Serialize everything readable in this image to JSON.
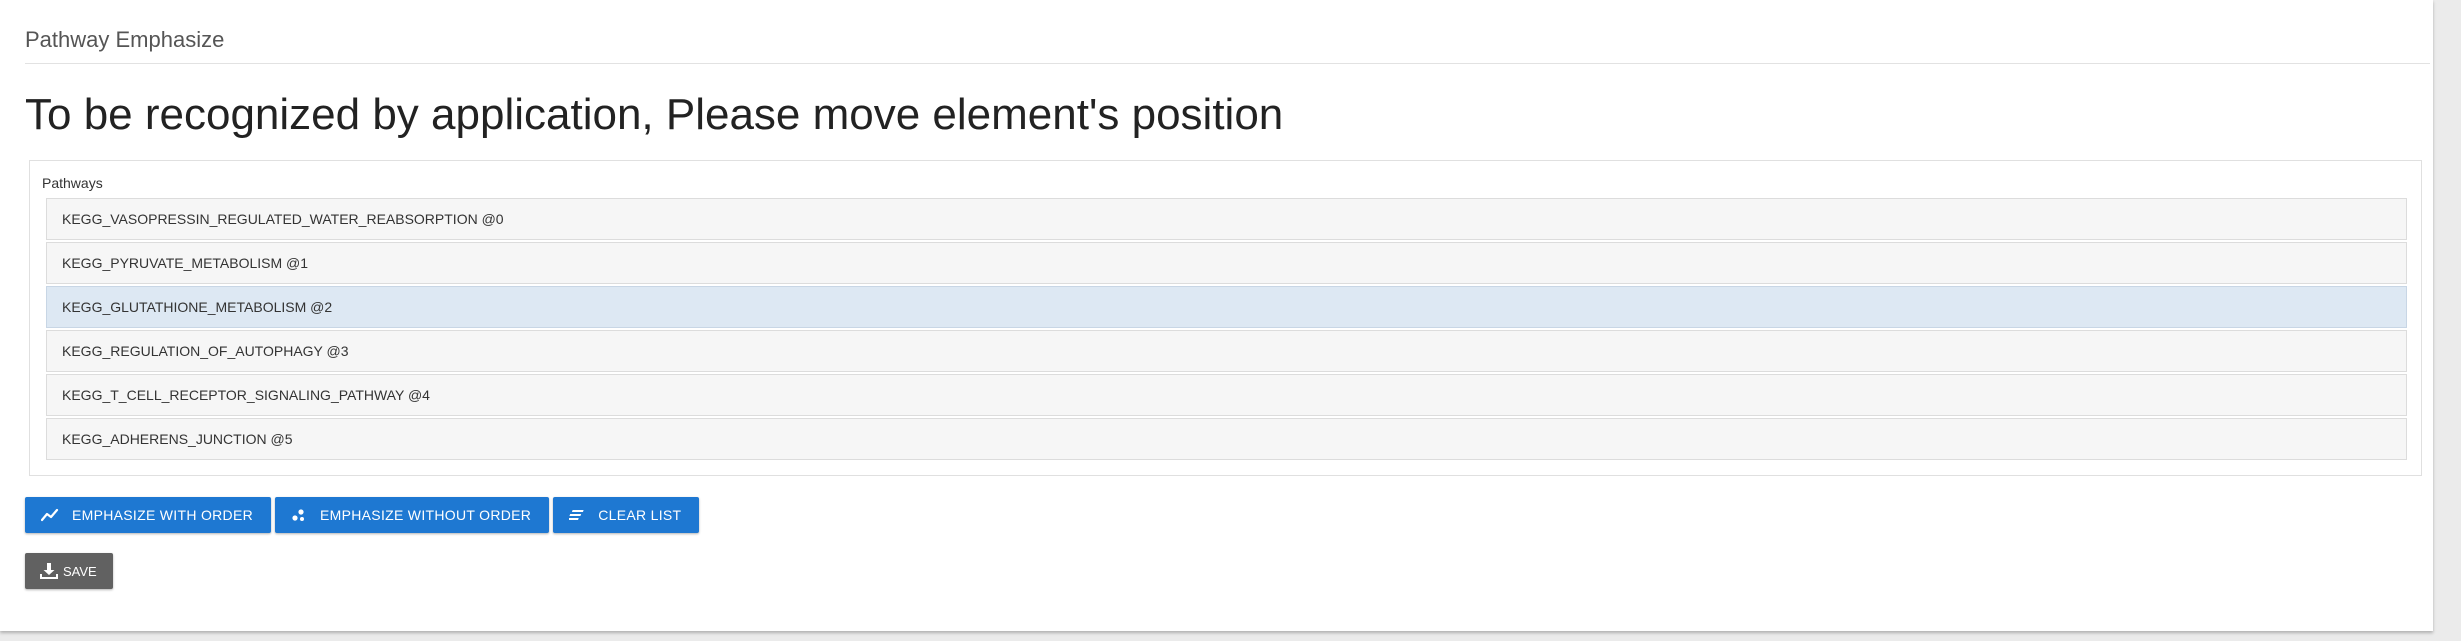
{
  "panel": {
    "title": "Pathway Emphasize",
    "headline": "To be recognized by application, Please move element's position"
  },
  "pathways": {
    "label": "Pathways",
    "items": [
      {
        "label": "KEGG_VASOPRESSIN_REGULATED_WATER_REABSORPTION @0",
        "selected": false
      },
      {
        "label": "KEGG_PYRUVATE_METABOLISM @1",
        "selected": false
      },
      {
        "label": "KEGG_GLUTATHIONE_METABOLISM @2",
        "selected": true
      },
      {
        "label": "KEGG_REGULATION_OF_AUTOPHAGY @3",
        "selected": false
      },
      {
        "label": "KEGG_T_CELL_RECEPTOR_SIGNALING_PATHWAY @4",
        "selected": false
      },
      {
        "label": "KEGG_ADHERENS_JUNCTION @5",
        "selected": false
      }
    ]
  },
  "actions": {
    "emphasize_with_order": {
      "label": "EMPHASIZE WITH ORDER",
      "icon": "line-chart-icon"
    },
    "emphasize_without_order": {
      "label": "EMPHASIZE WITHOUT ORDER",
      "icon": "scatter-icon"
    },
    "clear_list": {
      "label": "CLEAR LIST",
      "icon": "clear-format-icon"
    },
    "save": {
      "label": "SAVE",
      "icon": "download-icon"
    }
  },
  "colors": {
    "primary": "#1e78d2",
    "save": "#616161",
    "selected_row": "#dde8f3"
  }
}
